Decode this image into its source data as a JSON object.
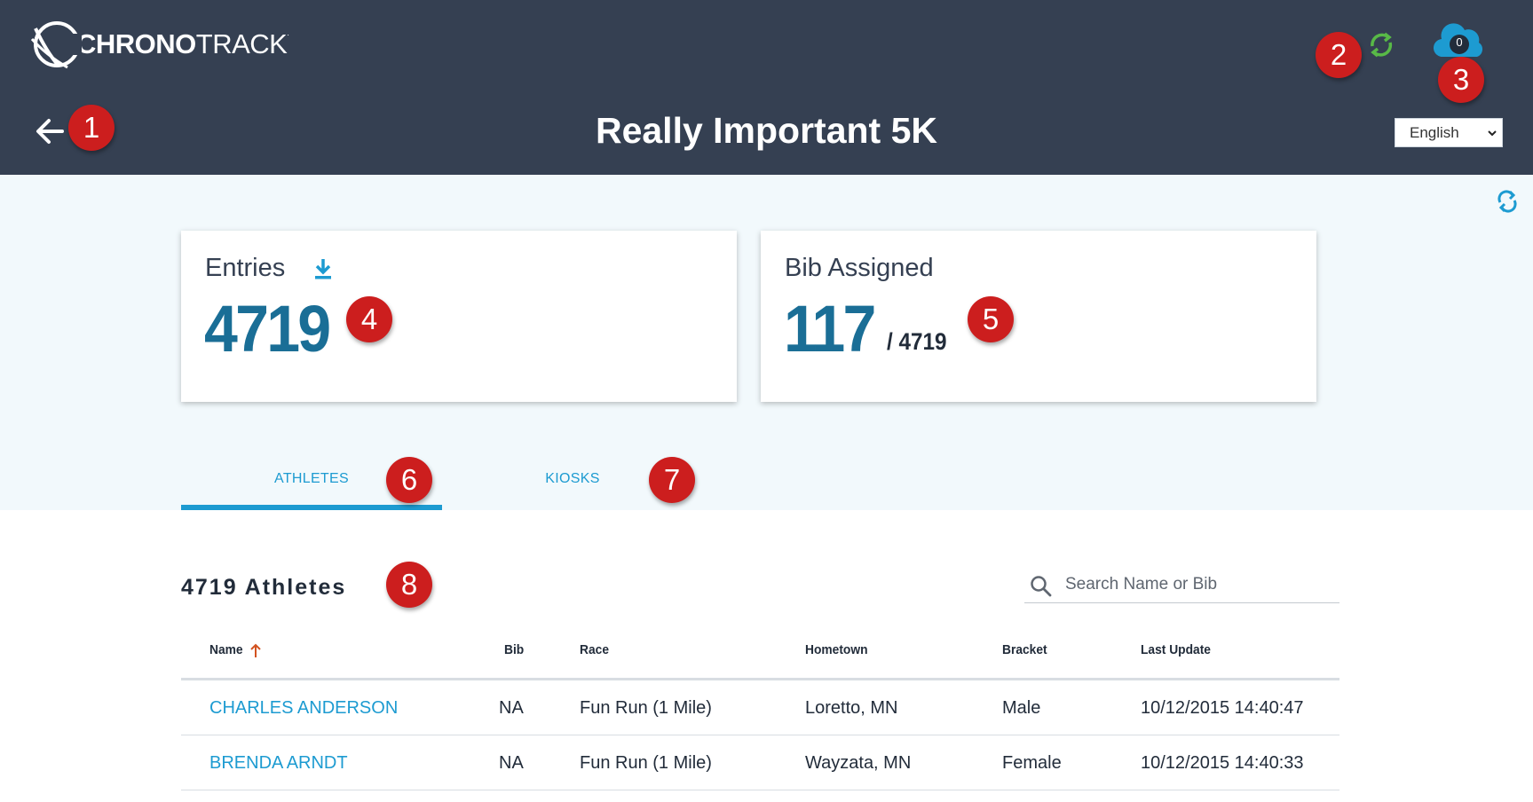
{
  "header": {
    "logo_text_bold": "CHRONO",
    "logo_text_light": "TRACK",
    "logo_mark": ".",
    "title": "Really Important 5K",
    "cloud_count": "0",
    "language": "English"
  },
  "markers": [
    "1",
    "2",
    "3",
    "4",
    "5",
    "6",
    "7",
    "8"
  ],
  "cards": {
    "entries": {
      "title": "Entries",
      "value": "4719"
    },
    "bib": {
      "title": "Bib Assigned",
      "value": "117",
      "total": "/ 4719"
    }
  },
  "tabs": [
    {
      "label": "ATHLETES",
      "active": true
    },
    {
      "label": "KIOSKS",
      "active": false
    }
  ],
  "athletes": {
    "count_label": "4719 Athletes",
    "search_placeholder": "Search Name or Bib",
    "columns": [
      "Name",
      "Bib",
      "Race",
      "Hometown",
      "Bracket",
      "Last Update"
    ],
    "rows": [
      {
        "name": "CHARLES ANDERSON",
        "bib": "NA",
        "race": "Fun Run (1 Mile)",
        "hometown": "Loretto, MN",
        "bracket": "Male",
        "last_update": "10/12/2015 14:40:47"
      },
      {
        "name": "BRENDA ARNDT",
        "bib": "NA",
        "race": "Fun Run (1 Mile)",
        "hometown": "Wayzata, MN",
        "bracket": "Female",
        "last_update": "10/12/2015 14:40:33"
      }
    ]
  },
  "colors": {
    "header_bg": "#354052",
    "accent": "#1d9bd1",
    "marker": "#cc1e1e",
    "sync_green": "#58b947",
    "big_number": "#1a6e96"
  },
  "icons": [
    "back-arrow-icon",
    "sync-icon",
    "cloud-icon",
    "download-icon",
    "refresh-icon",
    "search-icon",
    "sort-up-arrow-icon",
    "chevron-down-icon"
  ]
}
